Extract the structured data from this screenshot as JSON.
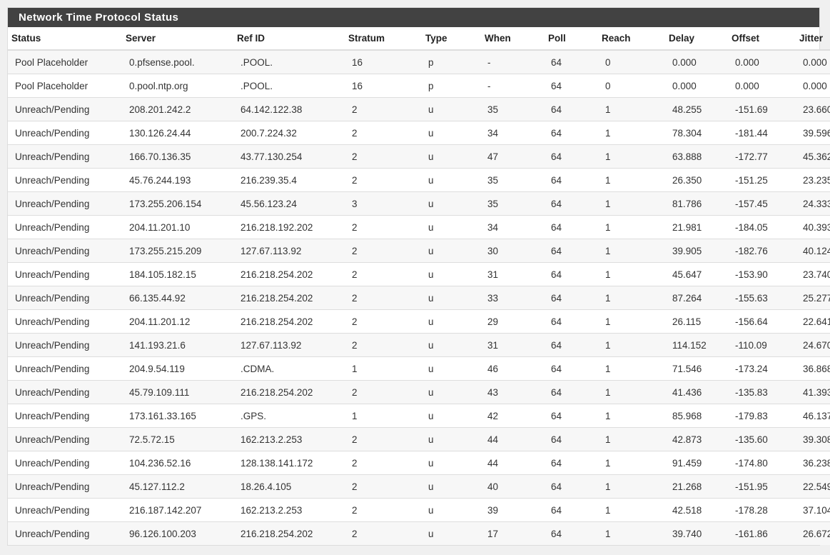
{
  "panel": {
    "title": "Network Time Protocol Status"
  },
  "columns": {
    "status": "Status",
    "server": "Server",
    "refid": "Ref ID",
    "stratum": "Stratum",
    "type": "Type",
    "when": "When",
    "poll": "Poll",
    "reach": "Reach",
    "delay": "Delay",
    "offset": "Offset",
    "jitter": "Jitter"
  },
  "rows": [
    {
      "status": "Pool Placeholder",
      "server": "0.pfsense.pool.",
      "refid": ".POOL.",
      "stratum": "16",
      "type": "p",
      "when": "-",
      "poll": "64",
      "reach": "0",
      "delay": "0.000",
      "offset": "0.000",
      "jitter": "0.000"
    },
    {
      "status": "Pool Placeholder",
      "server": "0.pool.ntp.org",
      "refid": ".POOL.",
      "stratum": "16",
      "type": "p",
      "when": "-",
      "poll": "64",
      "reach": "0",
      "delay": "0.000",
      "offset": "0.000",
      "jitter": "0.000"
    },
    {
      "status": "Unreach/Pending",
      "server": "208.201.242.2",
      "refid": "64.142.122.38",
      "stratum": "2",
      "type": "u",
      "when": "35",
      "poll": "64",
      "reach": "1",
      "delay": "48.255",
      "offset": "-151.69",
      "jitter": "23.660"
    },
    {
      "status": "Unreach/Pending",
      "server": "130.126.24.44",
      "refid": "200.7.224.32",
      "stratum": "2",
      "type": "u",
      "when": "34",
      "poll": "64",
      "reach": "1",
      "delay": "78.304",
      "offset": "-181.44",
      "jitter": "39.596"
    },
    {
      "status": "Unreach/Pending",
      "server": "166.70.136.35",
      "refid": "43.77.130.254",
      "stratum": "2",
      "type": "u",
      "when": "47",
      "poll": "64",
      "reach": "1",
      "delay": "63.888",
      "offset": "-172.77",
      "jitter": "45.362"
    },
    {
      "status": "Unreach/Pending",
      "server": "45.76.244.193",
      "refid": "216.239.35.4",
      "stratum": "2",
      "type": "u",
      "when": "35",
      "poll": "64",
      "reach": "1",
      "delay": "26.350",
      "offset": "-151.25",
      "jitter": "23.235"
    },
    {
      "status": "Unreach/Pending",
      "server": "173.255.206.154",
      "refid": "45.56.123.24",
      "stratum": "3",
      "type": "u",
      "when": "35",
      "poll": "64",
      "reach": "1",
      "delay": "81.786",
      "offset": "-157.45",
      "jitter": "24.333"
    },
    {
      "status": "Unreach/Pending",
      "server": "204.11.201.10",
      "refid": "216.218.192.202",
      "stratum": "2",
      "type": "u",
      "when": "34",
      "poll": "64",
      "reach": "1",
      "delay": "21.981",
      "offset": "-184.05",
      "jitter": "40.393"
    },
    {
      "status": "Unreach/Pending",
      "server": "173.255.215.209",
      "refid": "127.67.113.92",
      "stratum": "2",
      "type": "u",
      "when": "30",
      "poll": "64",
      "reach": "1",
      "delay": "39.905",
      "offset": "-182.76",
      "jitter": "40.124"
    },
    {
      "status": "Unreach/Pending",
      "server": "184.105.182.15",
      "refid": "216.218.254.202",
      "stratum": "2",
      "type": "u",
      "when": "31",
      "poll": "64",
      "reach": "1",
      "delay": "45.647",
      "offset": "-153.90",
      "jitter": "23.740"
    },
    {
      "status": "Unreach/Pending",
      "server": "66.135.44.92",
      "refid": "216.218.254.202",
      "stratum": "2",
      "type": "u",
      "when": "33",
      "poll": "64",
      "reach": "1",
      "delay": "87.264",
      "offset": "-155.63",
      "jitter": "25.277"
    },
    {
      "status": "Unreach/Pending",
      "server": "204.11.201.12",
      "refid": "216.218.254.202",
      "stratum": "2",
      "type": "u",
      "when": "29",
      "poll": "64",
      "reach": "1",
      "delay": "26.115",
      "offset": "-156.64",
      "jitter": "22.641"
    },
    {
      "status": "Unreach/Pending",
      "server": "141.193.21.6",
      "refid": "127.67.113.92",
      "stratum": "2",
      "type": "u",
      "when": "31",
      "poll": "64",
      "reach": "1",
      "delay": "114.152",
      "offset": "-110.09",
      "jitter": "24.670"
    },
    {
      "status": "Unreach/Pending",
      "server": "204.9.54.119",
      "refid": ".CDMA.",
      "stratum": "1",
      "type": "u",
      "when": "46",
      "poll": "64",
      "reach": "1",
      "delay": "71.546",
      "offset": "-173.24",
      "jitter": "36.868"
    },
    {
      "status": "Unreach/Pending",
      "server": "45.79.109.111",
      "refid": "216.218.254.202",
      "stratum": "2",
      "type": "u",
      "when": "43",
      "poll": "64",
      "reach": "1",
      "delay": "41.436",
      "offset": "-135.83",
      "jitter": "41.393"
    },
    {
      "status": "Unreach/Pending",
      "server": "173.161.33.165",
      "refid": ".GPS.",
      "stratum": "1",
      "type": "u",
      "when": "42",
      "poll": "64",
      "reach": "1",
      "delay": "85.968",
      "offset": "-179.83",
      "jitter": "46.137"
    },
    {
      "status": "Unreach/Pending",
      "server": "72.5.72.15",
      "refid": "162.213.2.253",
      "stratum": "2",
      "type": "u",
      "when": "44",
      "poll": "64",
      "reach": "1",
      "delay": "42.873",
      "offset": "-135.60",
      "jitter": "39.308"
    },
    {
      "status": "Unreach/Pending",
      "server": "104.236.52.16",
      "refid": "128.138.141.172",
      "stratum": "2",
      "type": "u",
      "when": "44",
      "poll": "64",
      "reach": "1",
      "delay": "91.459",
      "offset": "-174.80",
      "jitter": "36.238"
    },
    {
      "status": "Unreach/Pending",
      "server": "45.127.112.2",
      "refid": "18.26.4.105",
      "stratum": "2",
      "type": "u",
      "when": "40",
      "poll": "64",
      "reach": "1",
      "delay": "21.268",
      "offset": "-151.95",
      "jitter": "22.549"
    },
    {
      "status": "Unreach/Pending",
      "server": "216.187.142.207",
      "refid": "162.213.2.253",
      "stratum": "2",
      "type": "u",
      "when": "39",
      "poll": "64",
      "reach": "1",
      "delay": "42.518",
      "offset": "-178.28",
      "jitter": "37.104"
    },
    {
      "status": "Unreach/Pending",
      "server": "96.126.100.203",
      "refid": "216.218.254.202",
      "stratum": "2",
      "type": "u",
      "when": "17",
      "poll": "64",
      "reach": "1",
      "delay": "39.740",
      "offset": "-161.86",
      "jitter": "26.672"
    }
  ]
}
